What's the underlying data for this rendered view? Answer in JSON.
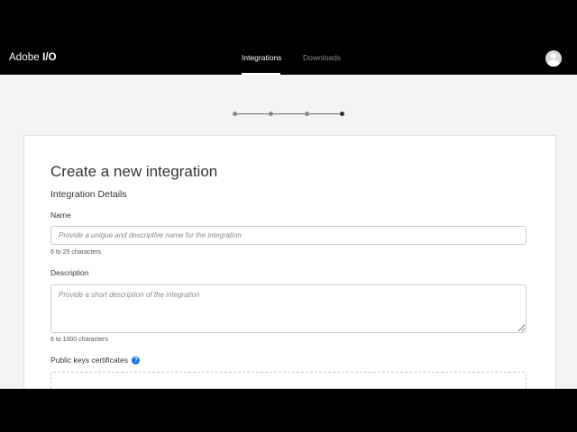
{
  "header": {
    "brand_regular": "Adobe",
    "brand_bold": "I/O",
    "tabs": [
      {
        "label": "Integrations",
        "active": true
      },
      {
        "label": "Downloads",
        "active": false
      }
    ],
    "avatar_icon": "user-avatar-icon"
  },
  "stepper": {
    "total_steps": 4,
    "current_step": 4
  },
  "form": {
    "title": "Create a new integration",
    "section_title": "Integration Details",
    "name": {
      "label": "Name",
      "value": "",
      "placeholder": "Provide a unique and descriptive name for the integration",
      "hint": "6 to 25 characters"
    },
    "description": {
      "label": "Description",
      "value": "",
      "placeholder": "Provide a short description of the integration",
      "hint": "6 to 1000 characters"
    },
    "certificates": {
      "label": "Public keys certificates",
      "help_icon": "help-question-icon",
      "help_glyph": "?"
    }
  },
  "colors": {
    "nav_background": "#000000",
    "page_background": "#f3f3f3",
    "accent_blue": "#1473e6"
  }
}
